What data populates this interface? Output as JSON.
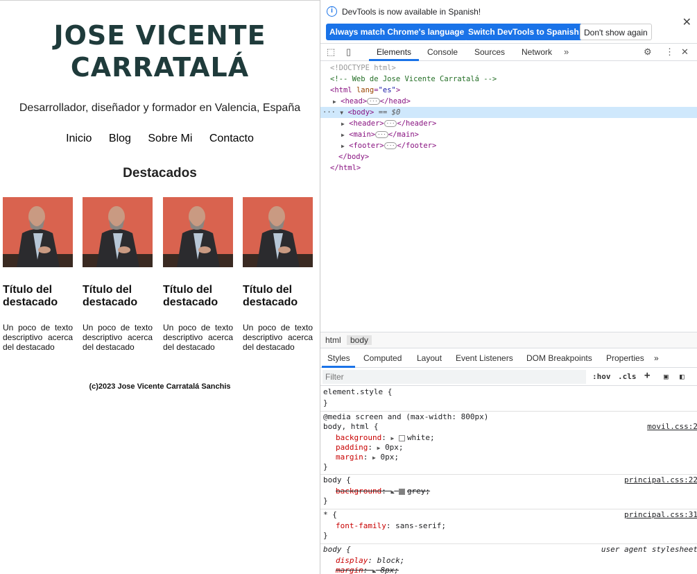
{
  "website": {
    "title": "JOSE VICENTE CARRATALÁ",
    "tagline": "Desarrollador, diseñador y formador en Valencia, España",
    "nav": [
      "Inicio",
      "Blog",
      "Sobre Mi",
      "Contacto"
    ],
    "featured_heading": "Destacados",
    "cards": [
      {
        "title": "Título del destacado",
        "text": "Un poco de texto descriptivo acerca del destacado"
      },
      {
        "title": "Título del destacado",
        "text": "Un poco de texto descriptivo acerca del destacado"
      },
      {
        "title": "Título del destacado",
        "text": "Un poco de texto descriptivo acerca del destacado"
      },
      {
        "title": "Título del destacado",
        "text": "Un poco de texto descriptivo acerca del destacado"
      }
    ],
    "footer": "(c)2023 Jose Vicente Carratalá Sanchis"
  },
  "devtools": {
    "notice": {
      "message": "DevTools is now available in Spanish!",
      "btn_match": "Always match Chrome's language",
      "btn_switch": "Switch DevTools to Spanish",
      "btn_dismiss": "Don't show again"
    },
    "tabs": [
      "Elements",
      "Console",
      "Sources",
      "Network"
    ],
    "active_tab": "Elements",
    "dom": {
      "doctype": "<!DOCTYPE html>",
      "comment": "<!-- Web de Jose Vicente Carratalá -->",
      "html_open": "<html",
      "lang_attr": "lang",
      "lang_val": "\"es\"",
      "head": "<head>",
      "head_close": "</head>",
      "body": "<body>",
      "body_marker": "== $0",
      "header": "<header>",
      "header_close": "</header>",
      "main": "<main>",
      "main_close": "</main>",
      "footer": "<footer>",
      "footer_close": "</footer>",
      "body_close": "</body>",
      "html_close": "</html>"
    },
    "breadcrumbs": [
      "html",
      "body"
    ],
    "sub_tabs": [
      "Styles",
      "Computed",
      "Layout",
      "Event Listeners",
      "DOM Breakpoints",
      "Properties"
    ],
    "filter_placeholder": "Filter",
    "filter_hov": ":hov",
    "filter_cls": ".cls",
    "styles": {
      "element_style": "element.style {",
      "close": "}",
      "media_query": "@media screen and (max-width: 800px)",
      "rule1_selector": "body, html {",
      "rule1_src": "movil.css:2",
      "rule1_props": [
        {
          "name": "background",
          "value": "white;"
        },
        {
          "name": "padding",
          "value": "0px;"
        },
        {
          "name": "margin",
          "value": "0px;"
        }
      ],
      "rule2_selector": "body {",
      "rule2_src": "principal.css:22",
      "rule2_prop": {
        "name": "background",
        "value": "grey;"
      },
      "rule3_selector": "* {",
      "rule3_src": "principal.css:31",
      "rule3_prop": {
        "name": "font-family",
        "value": "sans-serif;"
      },
      "rule4_selector": "body {",
      "rule4_src": "user agent stylesheet",
      "rule4_props": [
        {
          "name": "display",
          "value": "block;"
        },
        {
          "name": "margin",
          "value": "8px;"
        }
      ]
    },
    "colors": {
      "accent": "#1a73e8",
      "selected_row": "#cfe8fc",
      "tag": "#881280",
      "prop": "#c80000"
    }
  }
}
